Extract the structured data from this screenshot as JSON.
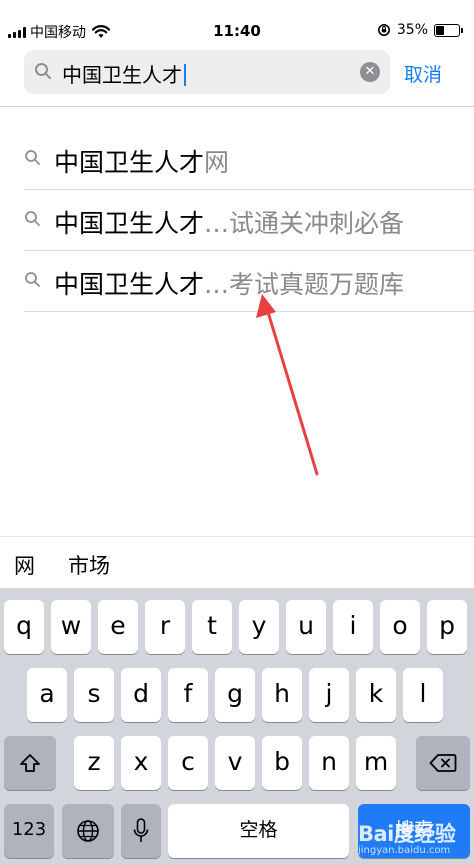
{
  "status_bar": {
    "carrier": "中国移动",
    "time": "11:40",
    "battery": "35%",
    "battery_level": 0.35
  },
  "search": {
    "query": "中国卫生人才",
    "cancel_label": "取消"
  },
  "suggestions": [
    {
      "match": "中国卫生人才",
      "rest": "网"
    },
    {
      "match": "中国卫生人才",
      "rest": "…试通关冲刺必备"
    },
    {
      "match": "中国卫生人才",
      "rest": "…考试真题万题库"
    }
  ],
  "candidates": [
    "网",
    "市场"
  ],
  "keyboard": {
    "row1": [
      "q",
      "w",
      "e",
      "r",
      "t",
      "y",
      "u",
      "i",
      "o",
      "p"
    ],
    "row2": [
      "a",
      "s",
      "d",
      "f",
      "g",
      "h",
      "j",
      "k",
      "l"
    ],
    "row3": [
      "z",
      "x",
      "c",
      "v",
      "b",
      "n",
      "m"
    ],
    "numbers_label": "123",
    "space_label": "空格",
    "search_label": "搜索"
  },
  "watermark": {
    "main": "Bai度经验",
    "sub": "jingyan.baidu.com"
  },
  "colors": {
    "accent": "#1a7cf5",
    "arrow": "#e8413f",
    "keyboard_bg": "#d2d5db"
  }
}
